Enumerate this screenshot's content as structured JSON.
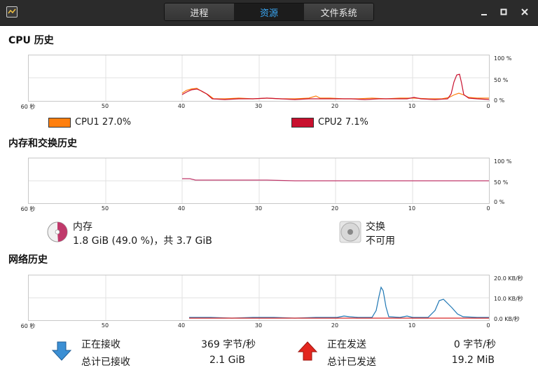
{
  "tabs": [
    {
      "label": "进程"
    },
    {
      "label": "资源"
    },
    {
      "label": "文件系统"
    }
  ],
  "window": {
    "minimize": "_",
    "maximize": "□",
    "close": "✕"
  },
  "cpu": {
    "title": "CPU 历史",
    "x_labels": [
      "60 秒",
      "50",
      "40",
      "30",
      "20",
      "10",
      "0"
    ],
    "y_labels": [
      "100 %",
      "50 %",
      "0 %"
    ],
    "legend": [
      {
        "name": "CPU1",
        "value": "27.0%",
        "color": "#ff7f0e"
      },
      {
        "name": "CPU2",
        "value": "7.1%",
        "color": "#c8102e"
      }
    ]
  },
  "memory": {
    "title": "内存和交换历史",
    "x_labels": [
      "60 秒",
      "50",
      "40",
      "30",
      "20",
      "10",
      "0"
    ],
    "y_labels": [
      "100 %",
      "50 %",
      "0 %"
    ],
    "mem_label": "内存",
    "mem_value": "1.8 GiB (49.0 %)，共 3.7 GiB",
    "swap_label": "交换",
    "swap_value": "不可用",
    "mem_color": "#c0396b"
  },
  "network": {
    "title": "网络历史",
    "x_labels": [
      "60 秒",
      "50",
      "40",
      "30",
      "20",
      "10",
      "0"
    ],
    "y_labels": [
      "20.0 KB/秒",
      "10.0 KB/秒",
      "0.0 KB/秒"
    ],
    "receiving_label": "正在接收",
    "receiving_value": "369 字节/秒",
    "total_received_label": "总计已接收",
    "total_received_value": "2.1 GiB",
    "sending_label": "正在发送",
    "sending_value": "0 字节/秒",
    "total_sent_label": "总计已发送",
    "total_sent_value": "19.2 MiB",
    "receive_color": "#1f77b4",
    "send_color": "#d62728"
  }
}
